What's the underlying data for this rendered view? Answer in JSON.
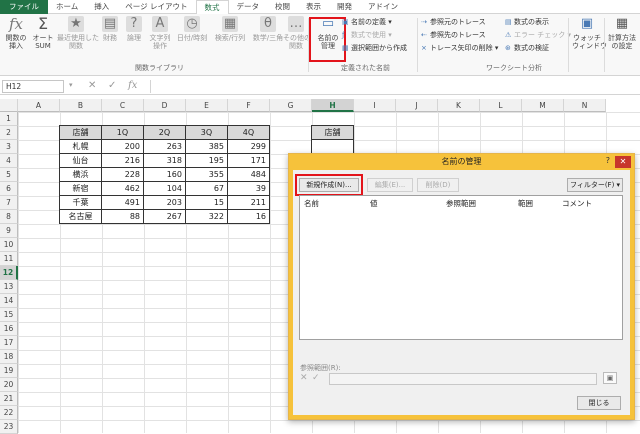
{
  "ribbon_tabs": [
    "ファイル",
    "ホーム",
    "挿入",
    "ページ レイアウト",
    "数式",
    "データ",
    "校閲",
    "表示",
    "開発",
    "アドイン"
  ],
  "ribbon": {
    "insert_function": "関数の\n挿入",
    "autosum": "オート\nSUM",
    "recent": "最近使用した\n関数",
    "financial": "財務",
    "logical": "論理",
    "text": "文字列\n操作",
    "datetime": "日付/時刻",
    "lookup": "検索/行列",
    "math": "数学/三角",
    "more": "その他の\n関数",
    "group_library": "関数ライブラリ",
    "name_manager": "名前の\n管理",
    "define_name": "名前の定義",
    "use_in_formula": "数式で使用",
    "create_from_selection": "選択範囲から作成",
    "group_defined": "定義された名前",
    "trace_precedents": "参照元のトレース",
    "trace_dependents": "参照先のトレース",
    "remove_arrows": "トレース矢印の削除",
    "show_formulas": "数式の表示",
    "error_check": "エラー チェック",
    "evaluate": "数式の検証",
    "group_audit": "ワークシート分析",
    "watch": "ウォッチ\nウィンドウ",
    "calc_options": "計算方法\nの設定"
  },
  "formula_bar": {
    "name_box": "H12",
    "fx": "fx",
    "cancel": "✕",
    "enter": "✓",
    "formula": ""
  },
  "columns": [
    "A",
    "B",
    "C",
    "D",
    "E",
    "F",
    "G",
    "H",
    "I",
    "J",
    "K",
    "L",
    "M",
    "N"
  ],
  "rows": [
    "1",
    "2",
    "3",
    "4",
    "5",
    "6",
    "7",
    "8",
    "9",
    "10",
    "11",
    "12",
    "13",
    "14",
    "15",
    "16",
    "17",
    "18",
    "19",
    "20",
    "21",
    "22",
    "23"
  ],
  "table": {
    "headers": [
      "店舗",
      "1Q",
      "2Q",
      "3Q",
      "4Q"
    ],
    "rows": [
      [
        "札幌",
        "200",
        "263",
        "385",
        "299"
      ],
      [
        "仙台",
        "216",
        "318",
        "195",
        "171"
      ],
      [
        "横浜",
        "228",
        "160",
        "355",
        "484"
      ],
      [
        "新宿",
        "462",
        "104",
        "67",
        "39"
      ],
      [
        "千葉",
        "491",
        "203",
        "15",
        "211"
      ],
      [
        "名古屋",
        "88",
        "267",
        "322",
        "16"
      ]
    ]
  },
  "h_header": "店舗",
  "dialog": {
    "title": "名前の管理",
    "help": "?",
    "close": "✕",
    "new_button": "新規作成(N)...",
    "edit_button": "編集(E)...",
    "delete_button": "削除(D)",
    "filter_button": "フィルター(F) ▾",
    "columns": [
      "名前",
      "値",
      "参照範囲",
      "範囲",
      "コメント"
    ],
    "refers_to_label": "参照範囲(R):",
    "refers_to_value": "",
    "close_button": "閉じる"
  }
}
